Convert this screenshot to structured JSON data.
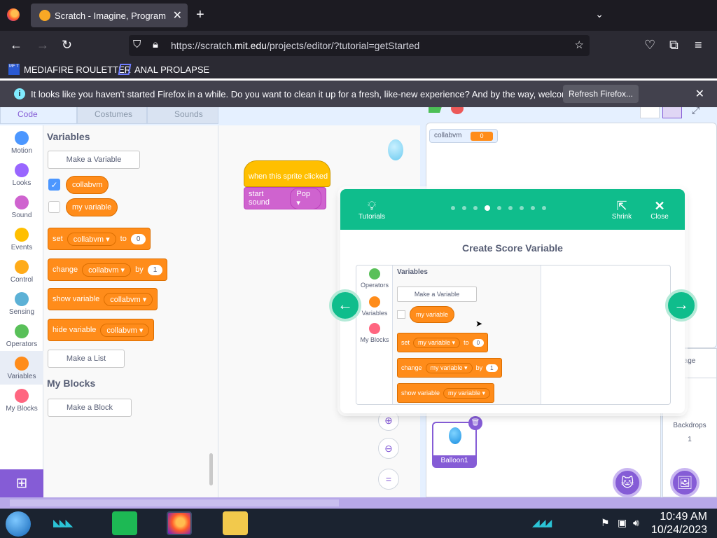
{
  "browser": {
    "tab_title": "Scratch - Imagine, Program, Sh",
    "url_prefix": "https://scratch.",
    "url_domain": "mit.edu",
    "url_path": "/projects/editor/?tutorial=getStarted",
    "bookmarks": [
      {
        "label": "MEDIAFIRE ROULETTER",
        "icon_text": "MF T"
      },
      {
        "label": "ANAL PROLAPSE"
      }
    ],
    "notification": {
      "text": "It looks like you haven't started Firefox in a while. Do you want to clean it up for a fresh, like-new experience? And by the way, welcome back!",
      "button": "Refresh Firefox..."
    }
  },
  "scratch": {
    "tabs": [
      "Code",
      "Costumes",
      "Sounds"
    ],
    "categories": [
      {
        "label": "Motion",
        "color": "#4c97ff"
      },
      {
        "label": "Looks",
        "color": "#9966ff"
      },
      {
        "label": "Sound",
        "color": "#cf63cf"
      },
      {
        "label": "Events",
        "color": "#ffbf00"
      },
      {
        "label": "Control",
        "color": "#ffab19"
      },
      {
        "label": "Sensing",
        "color": "#5cb1d6"
      },
      {
        "label": "Operators",
        "color": "#59c059"
      },
      {
        "label": "Variables",
        "color": "#ff8c1a"
      },
      {
        "label": "My Blocks",
        "color": "#ff6680"
      }
    ],
    "palette": {
      "variables_heading": "Variables",
      "make_variable": "Make a Variable",
      "variables": [
        "collabvm",
        "my variable"
      ],
      "set_block": {
        "word": "set",
        "var": "collabvm",
        "to": "to",
        "value": "0"
      },
      "change_block": {
        "word": "change",
        "var": "collabvm",
        "by": "by",
        "value": "1"
      },
      "show_block": {
        "word": "show variable",
        "var": "collabvm"
      },
      "hide_block": {
        "word": "hide variable",
        "var": "collabvm"
      },
      "make_list": "Make a List",
      "myblocks_heading": "My Blocks",
      "make_block": "Make a Block"
    },
    "script": {
      "hat": "when this sprite clicked",
      "sound": "start sound",
      "sound_value": "Pop"
    },
    "stage": {
      "monitor_name": "collabvm",
      "monitor_value": "0"
    },
    "sprite": {
      "name": "Balloon1"
    },
    "backdrops": {
      "label": "Backdrops",
      "count": "1",
      "stage_label": "age"
    }
  },
  "tutorial": {
    "tutorials_label": "Tutorials",
    "shrink_label": "Shrink",
    "close_label": "Close",
    "dots_total": 9,
    "active_dot": 4,
    "title": "Create Score Variable",
    "demo": {
      "categories": [
        "Operators",
        "Variables",
        "My Blocks"
      ],
      "heading": "Variables",
      "make_variable": "Make a Variable",
      "variable": "my variable",
      "set_block": {
        "word": "set",
        "var": "my variable",
        "to": "to",
        "value": "0"
      },
      "change_block": {
        "word": "change",
        "var": "my variable",
        "by": "by",
        "value": "1"
      },
      "show_block": {
        "word": "show variable",
        "var": "my variable"
      }
    }
  },
  "taskbar": {
    "time": "10:49 AM",
    "date": "10/24/2023"
  }
}
